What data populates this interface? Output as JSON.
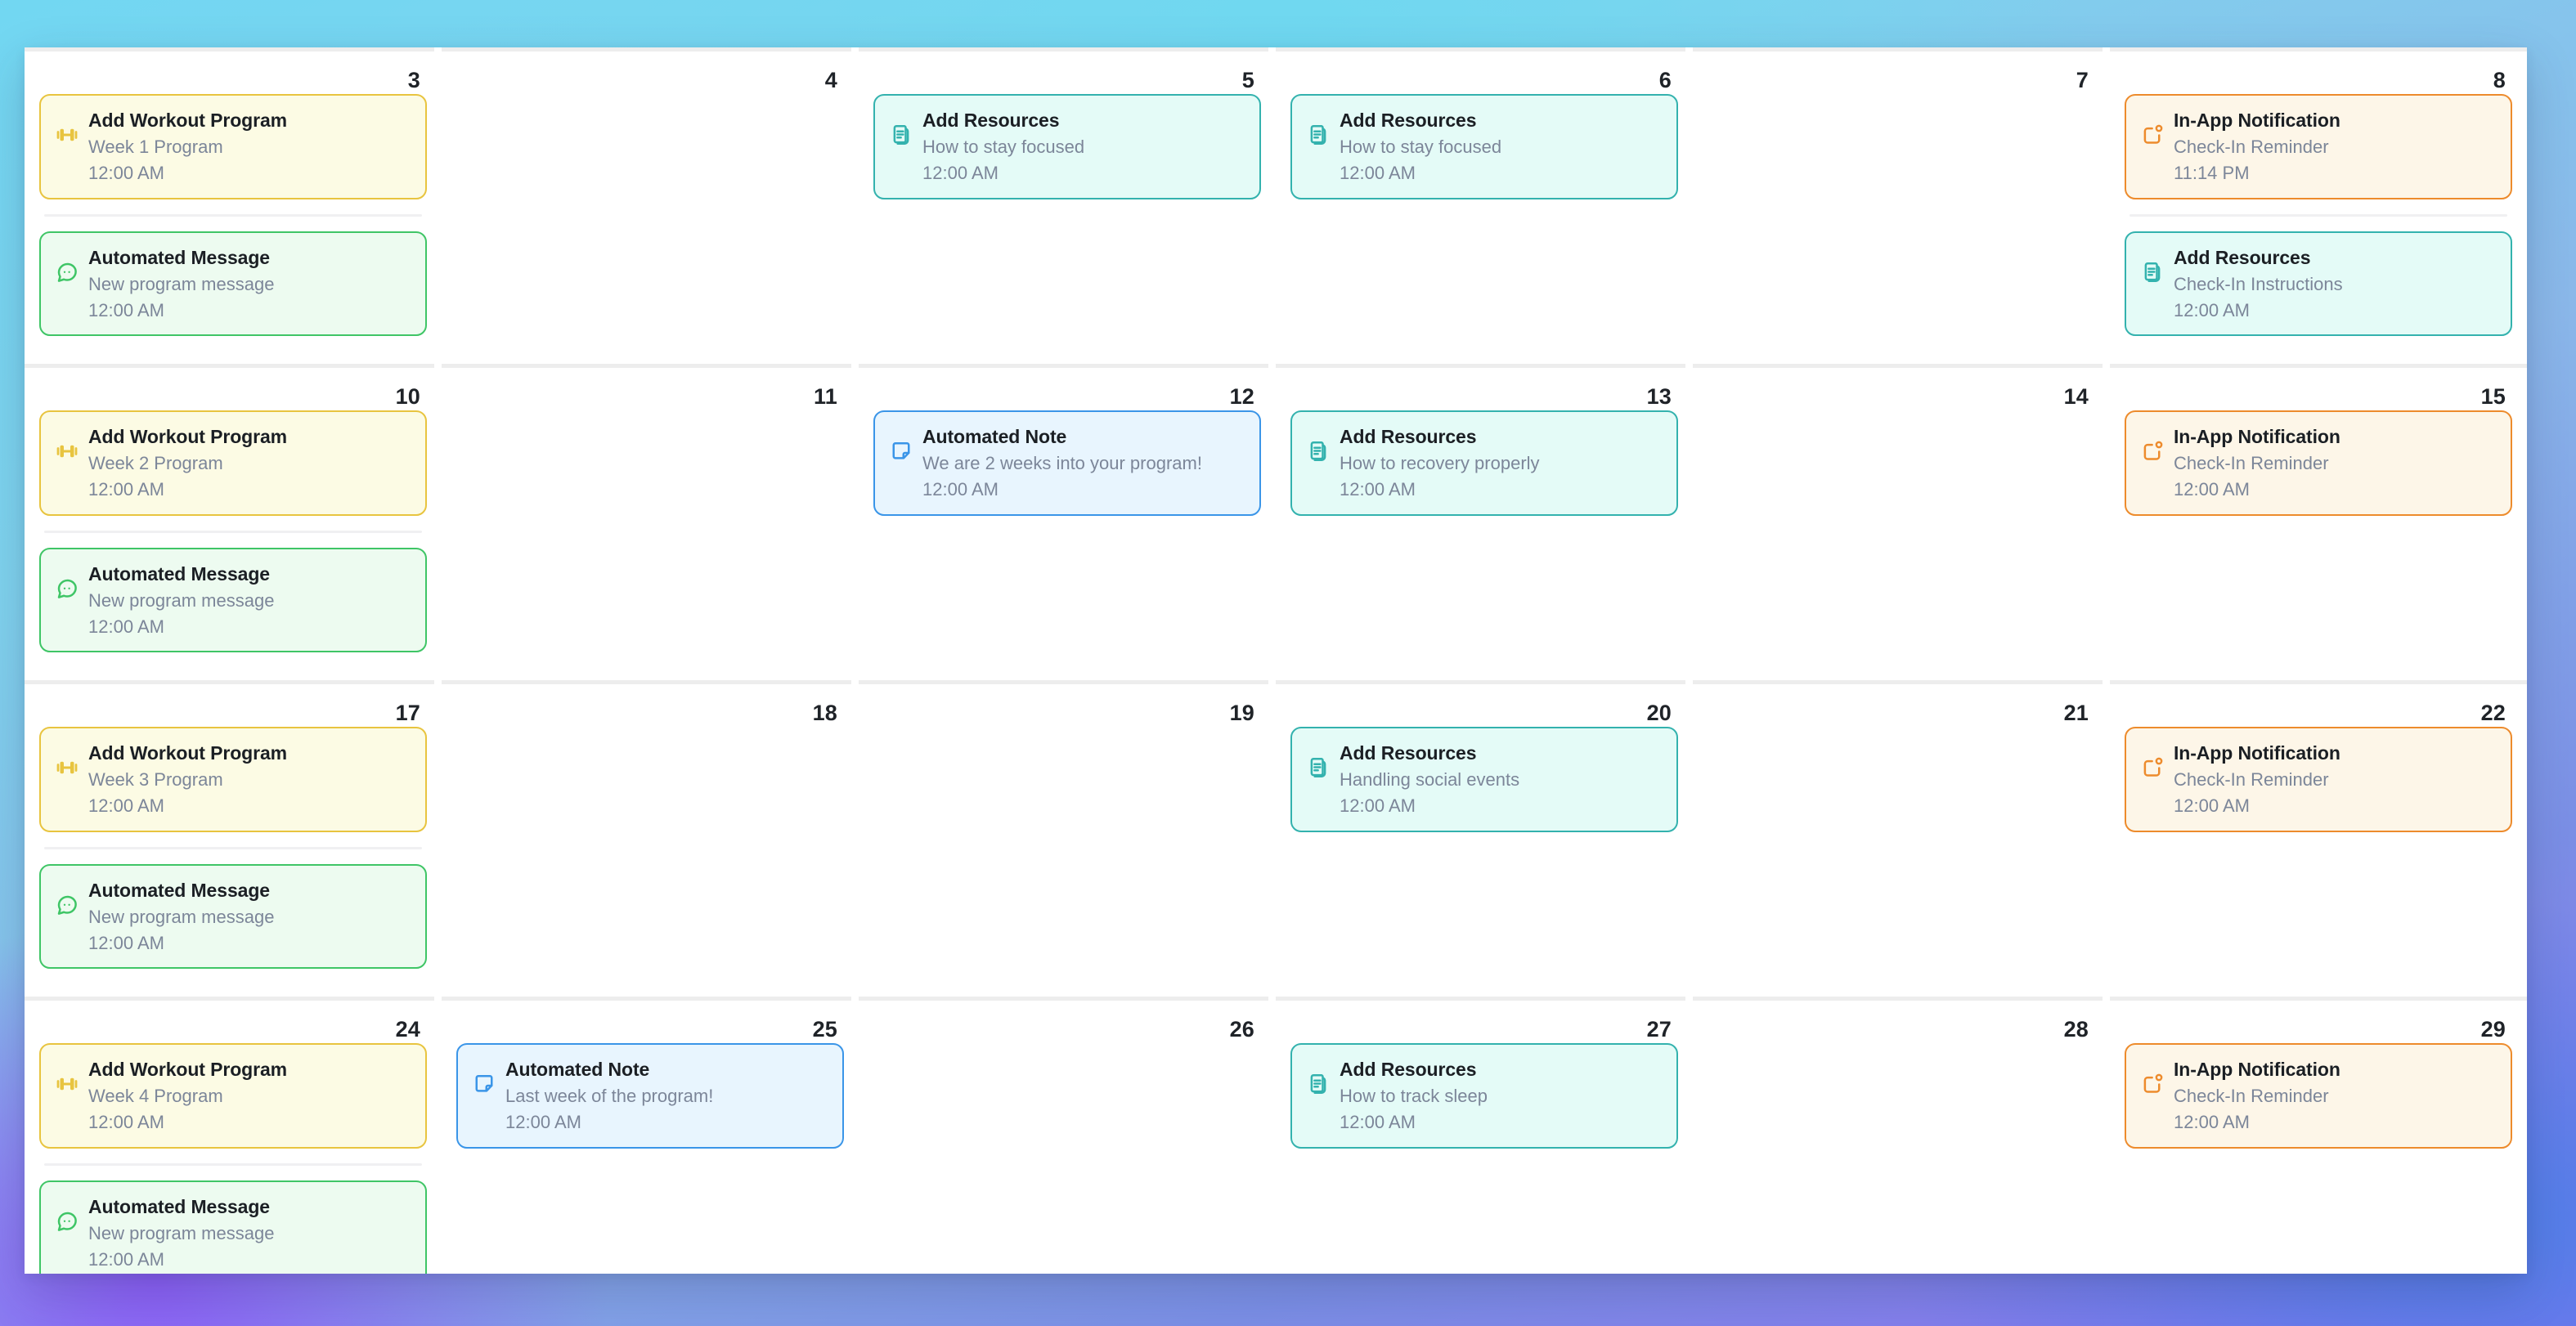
{
  "panel": {
    "view": "month",
    "columns": 6,
    "rows": 4
  },
  "theme_colors": {
    "workout": "#e8c43f",
    "workout_bg": "#fcfbe4",
    "message": "#3fc566",
    "message_bg": "#edfbf0",
    "resource": "#33b2ae",
    "resource_bg": "#e4fbf7",
    "notification": "#ed8b2c",
    "notification_bg": "#fdf6e8",
    "note": "#3a95e8",
    "note_bg": "#e8f5fe",
    "day_number": "#1f2328",
    "subtitle": "#7c8699",
    "separator": "#ededed"
  },
  "weeks": [
    {
      "days": [
        {
          "day_number": "3",
          "events": [
            {
              "title": "Add Workout Program",
              "subtitle": "Week 1 Program",
              "time": "12:00 AM",
              "theme": "workout",
              "icon": "dumbbell-icon"
            },
            {
              "title": "Automated Message",
              "subtitle": "New program message",
              "time": "12:00 AM",
              "theme": "message",
              "icon": "chat-bubble-icon"
            }
          ]
        },
        {
          "day_number": "4",
          "events": []
        },
        {
          "day_number": "5",
          "events": [
            {
              "title": "Add Resources",
              "subtitle": "How to stay focused",
              "time": "12:00 AM",
              "theme": "resource",
              "icon": "documents-icon"
            }
          ]
        },
        {
          "day_number": "6",
          "events": [
            {
              "title": "Add Resources",
              "subtitle": "How to stay focused",
              "time": "12:00 AM",
              "theme": "resource",
              "icon": "documents-icon"
            }
          ]
        },
        {
          "day_number": "7",
          "events": []
        },
        {
          "day_number": "8",
          "events": [
            {
              "title": "In-App Notification",
              "subtitle": "Check-In Reminder",
              "time": "11:14 PM",
              "theme": "notification",
              "icon": "notification-icon"
            },
            {
              "title": "Add Resources",
              "subtitle": "Check-In Instructions",
              "time": "12:00 AM",
              "theme": "resource",
              "icon": "documents-icon"
            }
          ]
        }
      ]
    },
    {
      "days": [
        {
          "day_number": "10",
          "events": [
            {
              "title": "Add Workout Program",
              "subtitle": "Week 2 Program",
              "time": "12:00 AM",
              "theme": "workout",
              "icon": "dumbbell-icon"
            },
            {
              "title": "Automated Message",
              "subtitle": "New program message",
              "time": "12:00 AM",
              "theme": "message",
              "icon": "chat-bubble-icon"
            }
          ]
        },
        {
          "day_number": "11",
          "events": []
        },
        {
          "day_number": "12",
          "events": [
            {
              "title": "Automated Note",
              "subtitle": "We are 2 weeks into your program!",
              "time": "12:00 AM",
              "theme": "note",
              "icon": "note-icon"
            }
          ]
        },
        {
          "day_number": "13",
          "events": [
            {
              "title": "Add Resources",
              "subtitle": "How to recovery properly",
              "time": "12:00 AM",
              "theme": "resource",
              "icon": "documents-icon"
            }
          ]
        },
        {
          "day_number": "14",
          "events": []
        },
        {
          "day_number": "15",
          "events": [
            {
              "title": "In-App Notification",
              "subtitle": "Check-In Reminder",
              "time": "12:00 AM",
              "theme": "notification",
              "icon": "notification-icon"
            }
          ]
        }
      ]
    },
    {
      "days": [
        {
          "day_number": "17",
          "events": [
            {
              "title": "Add Workout Program",
              "subtitle": "Week 3 Program",
              "time": "12:00 AM",
              "theme": "workout",
              "icon": "dumbbell-icon"
            },
            {
              "title": "Automated Message",
              "subtitle": "New program message",
              "time": "12:00 AM",
              "theme": "message",
              "icon": "chat-bubble-icon"
            }
          ]
        },
        {
          "day_number": "18",
          "events": []
        },
        {
          "day_number": "19",
          "events": []
        },
        {
          "day_number": "20",
          "events": [
            {
              "title": "Add Resources",
              "subtitle": "Handling social events",
              "time": "12:00 AM",
              "theme": "resource",
              "icon": "documents-icon"
            }
          ]
        },
        {
          "day_number": "21",
          "events": []
        },
        {
          "day_number": "22",
          "events": [
            {
              "title": "In-App Notification",
              "subtitle": "Check-In Reminder",
              "time": "12:00 AM",
              "theme": "notification",
              "icon": "notification-icon"
            }
          ]
        }
      ]
    },
    {
      "days": [
        {
          "day_number": "24",
          "events": [
            {
              "title": "Add Workout Program",
              "subtitle": "Week 4 Program",
              "time": "12:00 AM",
              "theme": "workout",
              "icon": "dumbbell-icon"
            },
            {
              "title": "Automated Message",
              "subtitle": "New program message",
              "time": "12:00 AM",
              "theme": "message",
              "icon": "chat-bubble-icon"
            }
          ]
        },
        {
          "day_number": "25",
          "events": [
            {
              "title": "Automated Note",
              "subtitle": "Last week of the program!",
              "time": "12:00 AM",
              "theme": "note",
              "icon": "note-icon"
            }
          ]
        },
        {
          "day_number": "26",
          "events": []
        },
        {
          "day_number": "27",
          "events": [
            {
              "title": "Add Resources",
              "subtitle": "How to track sleep",
              "time": "12:00 AM",
              "theme": "resource",
              "icon": "documents-icon"
            }
          ]
        },
        {
          "day_number": "28",
          "events": []
        },
        {
          "day_number": "29",
          "events": [
            {
              "title": "In-App Notification",
              "subtitle": "Check-In Reminder",
              "time": "12:00 AM",
              "theme": "notification",
              "icon": "notification-icon"
            }
          ]
        }
      ]
    }
  ]
}
